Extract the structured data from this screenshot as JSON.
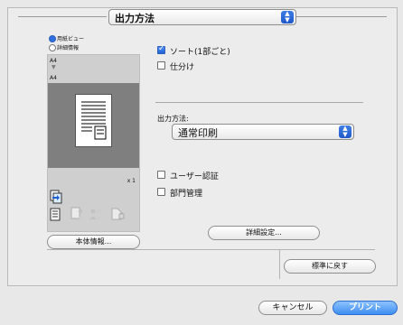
{
  "header": {
    "popup_label": "出力方法"
  },
  "left": {
    "view_options": [
      "用紙ビュー",
      "詳細情報"
    ],
    "paper_top": "A4",
    "paper_bottom": "A4",
    "copies": "x 1",
    "printer_info_button": "本体情報..."
  },
  "right": {
    "sort_label": "ソート(1部ごと)",
    "sort_checked": true,
    "divide_label": "仕分け",
    "divide_checked": false,
    "output_method_label": "出力方法:",
    "output_method_value": "通常印刷",
    "user_auth_label": "ユーザー認証",
    "user_auth_checked": false,
    "dept_manage_label": "部門管理",
    "dept_manage_checked": false,
    "detail_button": "詳細設定..."
  },
  "footer": {
    "reset_button": "標準に戻す",
    "cancel_button": "キャンセル",
    "print_button": "プリント"
  }
}
